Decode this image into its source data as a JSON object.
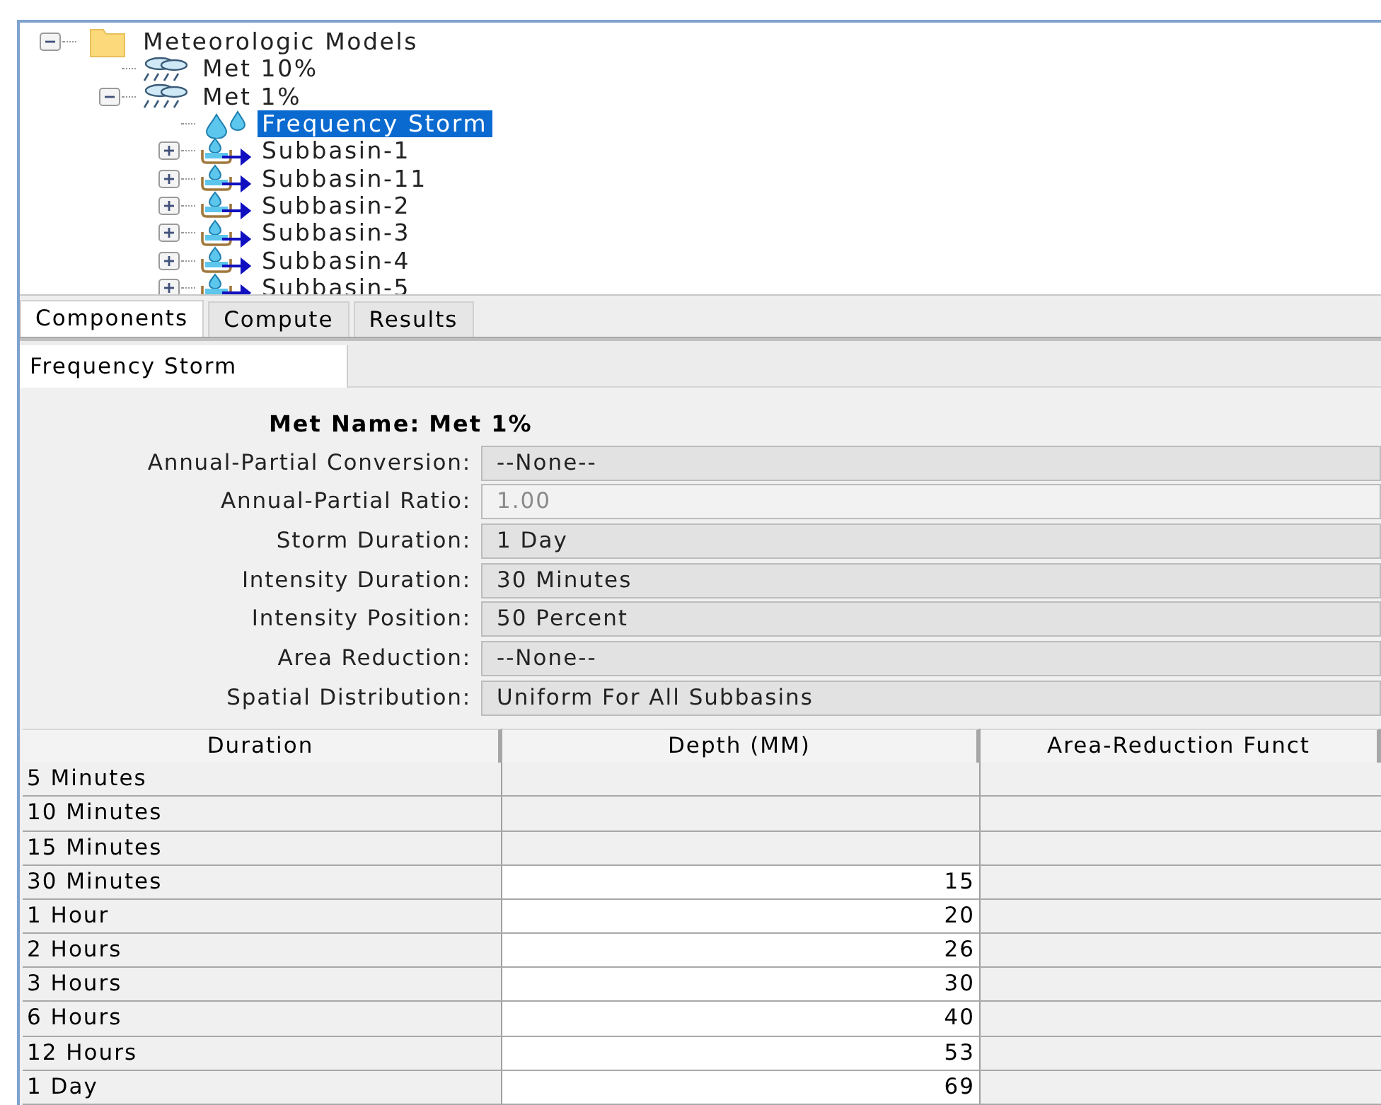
{
  "tree": [
    {
      "label": "Meteorologic Models",
      "kind": "folder",
      "expanded": true,
      "selected": false,
      "children": [
        {
          "label": "Met 10%",
          "kind": "met",
          "selected": false
        },
        {
          "label": "Met 1%",
          "kind": "met",
          "expanded": true,
          "selected": false,
          "children": [
            {
              "label": "Frequency Storm",
              "kind": "storm",
              "selected": true
            },
            {
              "label": "Subbasin-1",
              "kind": "subbasin",
              "expanded": false,
              "selected": false
            },
            {
              "label": "Subbasin-11",
              "kind": "subbasin",
              "expanded": false,
              "selected": false
            },
            {
              "label": "Subbasin-2",
              "kind": "subbasin",
              "expanded": false,
              "selected": false
            },
            {
              "label": "Subbasin-3",
              "kind": "subbasin",
              "expanded": false,
              "selected": false
            },
            {
              "label": "Subbasin-4",
              "kind": "subbasin",
              "expanded": false,
              "selected": false
            },
            {
              "label": "Subbasin-5",
              "kind": "subbasin",
              "expanded": false,
              "selected": false
            }
          ]
        }
      ]
    }
  ],
  "tabs": [
    {
      "label": "Components",
      "selected": true
    },
    {
      "label": "Compute",
      "selected": false
    },
    {
      "label": "Results",
      "selected": false
    }
  ],
  "subtabs": [
    {
      "label": "Frequency Storm",
      "selected": true
    }
  ],
  "met_name": {
    "label": "Met Name:",
    "value": "Met 1%"
  },
  "fields": [
    {
      "label": "Annual-Partial Conversion:",
      "value": "--None--",
      "disabled": false
    },
    {
      "label": "Annual-Partial Ratio:",
      "value": "1.00",
      "disabled": true
    },
    {
      "label": "Storm Duration:",
      "value": "1 Day",
      "disabled": false
    },
    {
      "label": "Intensity Duration:",
      "value": "30 Minutes",
      "disabled": false
    },
    {
      "label": "Intensity Position:",
      "value": "50 Percent",
      "disabled": false
    },
    {
      "label": "Area Reduction:",
      "value": "--None--",
      "disabled": false
    },
    {
      "label": "Spatial Distribution:",
      "value": "Uniform For All Subbasins",
      "disabled": false
    }
  ],
  "table": {
    "columns": [
      "Duration",
      "Depth (MM)",
      "Area-Reduction Funct"
    ],
    "rows": [
      {
        "duration": "5 Minutes",
        "depth": "",
        "editable": false
      },
      {
        "duration": "10 Minutes",
        "depth": "",
        "editable": false
      },
      {
        "duration": "15 Minutes",
        "depth": "",
        "editable": false
      },
      {
        "duration": "30 Minutes",
        "depth": "15",
        "editable": true
      },
      {
        "duration": "1 Hour",
        "depth": "20",
        "editable": true
      },
      {
        "duration": "2 Hours",
        "depth": "26",
        "editable": true
      },
      {
        "duration": "3 Hours",
        "depth": "30",
        "editable": true
      },
      {
        "duration": "6 Hours",
        "depth": "40",
        "editable": true
      },
      {
        "duration": "12 Hours",
        "depth": "53",
        "editable": true
      },
      {
        "duration": "1 Day",
        "depth": "69",
        "editable": true
      }
    ]
  }
}
